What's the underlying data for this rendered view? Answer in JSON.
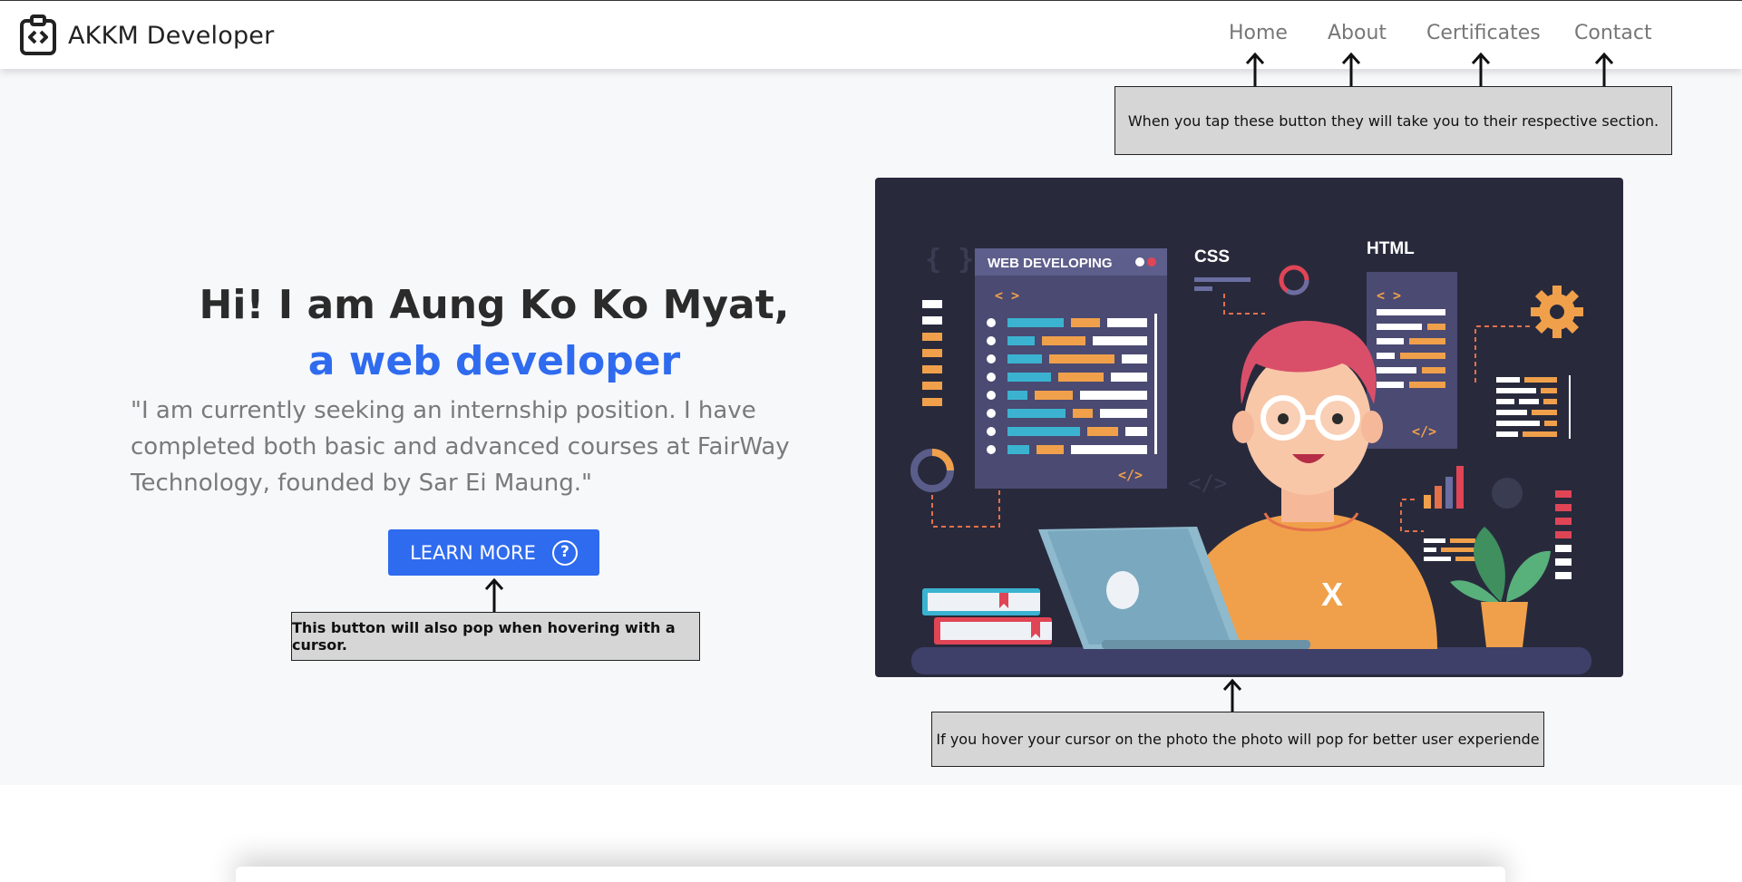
{
  "brand": {
    "name": "AKKM Developer",
    "logo_icon": "code-clipboard-icon"
  },
  "nav": {
    "items": [
      {
        "label": "Home"
      },
      {
        "label": "About"
      },
      {
        "label": "Certificates"
      },
      {
        "label": "Contact"
      }
    ]
  },
  "hero": {
    "greeting": "Hi! I am Aung Ko Ko Myat,",
    "role": "a web developer",
    "quote": "\"I am currently seeking an internship position. I have completed both basic and advanced courses at FairWay Technology, founded by Sar Ei Maung.\"",
    "cta_label": "LEARN MORE",
    "cta_icon": "question-circle-icon",
    "accent_color": "#2f6bef"
  },
  "illustration": {
    "panel_title": "WEB DEVELOPING",
    "labels": [
      "CSS",
      "HTML"
    ],
    "code_glyphs": [
      "< >",
      "</>"
    ],
    "letter_on_shirt": "X"
  },
  "annotations": {
    "nav_note": "When you tap these button they will take you to their respective section.",
    "button_note": "This button will also pop when hovering with a cursor.",
    "photo_note": "If you hover your cursor on the photo the photo will pop for better user experiende"
  }
}
